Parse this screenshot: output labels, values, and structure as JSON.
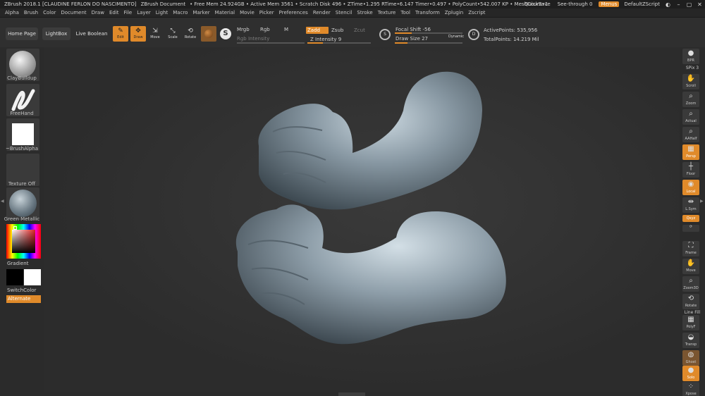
{
  "titlebar": {
    "app": "ZBrush 2018.1 [CLAUDINE FERLON DO NASCIMENTO]",
    "doc": "ZBrush Document",
    "stats": "• Free Mem 24.924GB • Active Mem 3561 • Scratch Disk 496 • ZTime•1.295 RTime•6.147 Timer•0.497 • PolyCount•542.007 KP • MeshCount•1",
    "quicksave": "QuickSave",
    "seethrough": "See-through  0",
    "menus": "Menus",
    "defaultzscript": "DefaultZScript"
  },
  "menubar": [
    "Alpha",
    "Brush",
    "Color",
    "Document",
    "Draw",
    "Edit",
    "File",
    "Layer",
    "Light",
    "Macro",
    "Marker",
    "Material",
    "Movie",
    "Picker",
    "Preferences",
    "Render",
    "Stencil",
    "Stroke",
    "Texture",
    "Tool",
    "Transform",
    "Zplugin",
    "Zscript"
  ],
  "shelf": {
    "home_page": "Home Page",
    "lightbox": "LightBox",
    "live_boolean": "Live Boolean",
    "edit": "Edit",
    "draw": "Draw",
    "move": "Move",
    "scale": "Scale",
    "rotate": "Rotate",
    "mrgb": "Mrgb",
    "rgb": "Rgb",
    "m": "M",
    "rgb_intensity": "Rgb Intensity",
    "zadd": "Zadd",
    "zsub": "Zsub",
    "zcut": "Zcut",
    "z_intensity": "Z Intensity 9",
    "z_intensity_value": 9,
    "focal_shift": "Focal Shift -56",
    "draw_size": "Draw Size 27",
    "dynamic": "Dynamic",
    "active_points": "ActivePoints: 535,956",
    "total_points": "TotalPoints: 14.219 Mil"
  },
  "left": {
    "brush": "ClayBuildup",
    "stroke": "FreeHand",
    "alpha": "~BrushAlpha",
    "texture": "Texture Off",
    "material": "Green Metallic",
    "gradient": "Gradient",
    "switchcolor": "SwitchColor",
    "alternate": "Alternate"
  },
  "right": {
    "bpr": "BPR",
    "spix": "SPix 3",
    "scroll": "Scroll",
    "zoom": "Zoom",
    "actual": "Actual",
    "aahalf": "AAHalf",
    "persp": "Persp",
    "floor": "Floor",
    "local": "Local",
    "lsym": "L.Sym",
    "xyz": "Qxyz",
    "frame": "Frame",
    "move": "Move",
    "zoom3d": "Zoom3D",
    "rotate": "Rotate",
    "linefill": "Line Fill",
    "polyf": "PolyF",
    "transp": "Transp",
    "ghost": "Ghost",
    "solo": "Solo",
    "xpose": "Xpose"
  },
  "colors": {
    "accent": "#e08a2a",
    "background": "#2b2b2b",
    "mesh": "#7f8f9b"
  }
}
